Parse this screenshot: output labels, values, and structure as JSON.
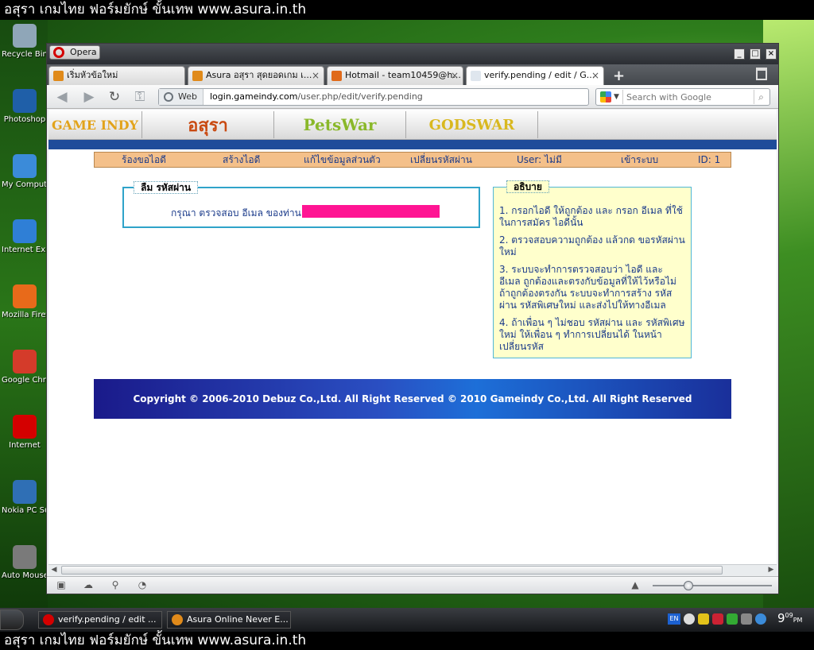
{
  "caption": "อสุรา เกมไทย ฟอร์มยักษ์ ขั้นเทพ www.asura.in.th",
  "desktop_icons": [
    {
      "label": "Recycle Bin",
      "icon": "recycle-bin-icon",
      "color": "#8fa6b8"
    },
    {
      "label": "Photoshop",
      "icon": "photoshop-icon",
      "color": "#1f5fa8"
    },
    {
      "label": "My Computer",
      "icon": "computer-icon",
      "color": "#3b8bd9"
    },
    {
      "label": "Internet Explorer",
      "icon": "ie-icon",
      "color": "#2f7fd6"
    },
    {
      "label": "Mozilla Firefox",
      "icon": "firefox-icon",
      "color": "#e86a1a"
    },
    {
      "label": "Google Chrome",
      "icon": "chrome-icon",
      "color": "#d43b2a"
    },
    {
      "label": "Internet",
      "icon": "opera-icon",
      "color": "#d40000"
    },
    {
      "label": "Nokia PC Suite",
      "icon": "nokia-icon",
      "color": "#2f6fb5"
    },
    {
      "label": "Auto Mouse",
      "icon": "mouse-icon",
      "color": "#7a7a7a"
    }
  ],
  "browser": {
    "menu_label": "Opera",
    "tabs": [
      {
        "title": "เริ่มหัวข้อใหม่",
        "color": "#e08a1a",
        "active": false
      },
      {
        "title": "Asura อสุรา สุดยอดเกม เ...",
        "color": "#e08a1a",
        "active": false
      },
      {
        "title": "Hotmail - team10459@h...",
        "color": "#e06a1a",
        "active": false
      },
      {
        "title": "verify.pending / edit / G...",
        "color": "#dfe6ee",
        "active": true
      }
    ],
    "address_scheme": "Web",
    "address_host": "login.gameindy.com",
    "address_path": "/user.php/edit/verify.pending",
    "search_placeholder": "Search with Google"
  },
  "site": {
    "logos": [
      "GAME INDY",
      "อสุรา",
      "PetsWar",
      "GODSWAR"
    ],
    "logo_colors": [
      "#e2a31a",
      "#c94a12",
      "#8ab82a",
      "#d9b81f"
    ],
    "menu": [
      "ร้องขอไอดี",
      "สร้างไอดี",
      "แก้ไขข้อมูลส่วนตัว",
      "เปลี่ยนรหัสผ่าน",
      "User: ไม่มี",
      "เข้าระบบ",
      "ID: 1"
    ],
    "forgot_title": "ลืม รหัสผ่าน",
    "forgot_label": "กรุณา ตรวจสอบ อีเมล ของท่าน",
    "help_title": "อธิบาย",
    "help_items": [
      "1. กรอกไอดี ให้ถูกต้อง และ กรอก อีเมล ที่ใช้ในการสมัคร ไอดีนั้น",
      "2. ตรวจสอบความถูกต้อง แล้วกด ขอรหัสผ่านใหม่",
      "3. ระบบจะทำการตรวจสอบว่า ไอดี และ อีเมล ถูกต้องและตรงกับข้อมูลที่ให้ไว้หรือไม่ ถ้าถูกต้องตรงกัน ระบบจะทำการสร้าง รหัสผ่าน รหัสพิเศษใหม่ และส่งไปให้ทางอีเมล",
      "4. ถ้าเพื่อน ๆ ไม่ชอบ รหัสผ่าน และ รหัสพิเศษใหม่ ให้เพื่อน ๆ ทำการเปลี่ยนได้ ในหน้าเปลี่ยนรหัส"
    ],
    "footer": "Copyright © 2006-2010 Debuz Co.,Ltd. All Right Reserved © 2010 Gameindy Co.,Ltd. All Right Reserved"
  },
  "taskbar": {
    "tasks": [
      {
        "title": "verify.pending / edit ...",
        "color": "#d40000"
      },
      {
        "title": "Asura Online Never E...",
        "color": "#e08a1a"
      }
    ],
    "lang": "EN",
    "clock_hour": "9",
    "clock_min": "09",
    "clock_ampm": "PM"
  },
  "zoom_fraction": 0.3
}
